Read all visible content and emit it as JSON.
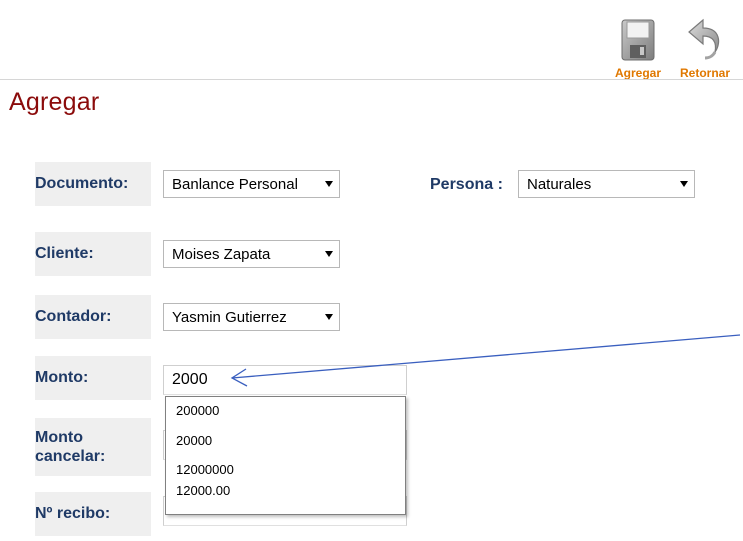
{
  "toolbar": {
    "agregar_label": "Agregar",
    "retornar_label": "Retornar",
    "icons": [
      "save-icon",
      "back-arrow-icon"
    ],
    "accent_color": "#e07800"
  },
  "page": {
    "title": "Agregar",
    "title_color": "#8b0b0b",
    "label_color": "#1f3a66"
  },
  "form": {
    "documento": {
      "label": "Documento:",
      "value": "Banlance Personal"
    },
    "persona": {
      "label": "Persona :",
      "value": "Naturales"
    },
    "cliente": {
      "label": "Cliente:",
      "value": "Moises Zapata"
    },
    "contador": {
      "label": "Contador:",
      "value": "Yasmin Gutierrez"
    },
    "monto": {
      "label": "Monto:",
      "value": "2000"
    },
    "monto_cancelar": {
      "label_line1": "Monto",
      "label_line2": "cancelar:"
    },
    "recibo": {
      "label": "Nº recibo:"
    }
  },
  "autocomplete": {
    "options": [
      "200000",
      "20000",
      "12000000",
      "12000.00"
    ]
  }
}
